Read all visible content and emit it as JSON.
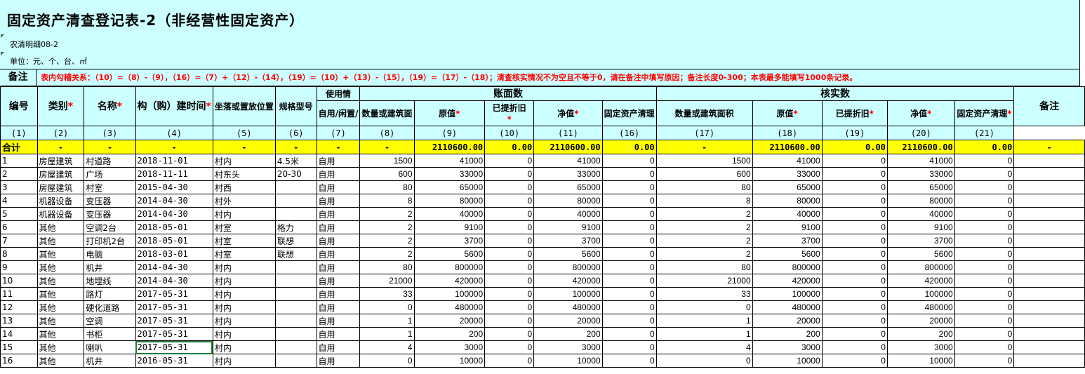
{
  "title": "固定资产清查登记表-2（非经营性固定资产）",
  "form_code": "农清明细08-2",
  "unit": "单位：元、个、台、㎡",
  "note": {
    "label": "备注",
    "text": "表内勾稽关系：（10）=（8）-（9），（16）=（7）+（12）-（14），（19）=（10）+（13）-（15），（19）=（17）-（18）；清查核实情况不为空且不等于0，请在备注中填写原因；备注长度0-300；本表最多能填写1000条记录。"
  },
  "headers": {
    "no": "编号",
    "category": "类别",
    "name": "名称",
    "build_time": "构（购）建时间",
    "location": "坐落或置放位置",
    "spec": "规格型号",
    "usage": "使用情",
    "usage_sub": "自用/闲置/",
    "book": "账面数",
    "book_qty": "数量或建筑面",
    "book_orig": "原值",
    "book_dep": "已提折旧",
    "book_net": "净值",
    "book_clear": "固定资产清理",
    "verify": "核实数",
    "ver_qty": "数量或建筑面积",
    "ver_orig": "原值",
    "ver_dep": "已提折旧",
    "ver_net": "净值",
    "ver_clear": "固定资产清理",
    "remark": "备注",
    "required_mark": "*"
  },
  "col_numbers": [
    "(1)",
    "(2)",
    "(3)",
    "(4)",
    "(5)",
    "(6)",
    "(7)",
    "(8)",
    "(9)",
    "(10)",
    "(11)",
    "(16)",
    "(17)",
    "(18)",
    "(19)",
    "(20)",
    "(21)"
  ],
  "totals": {
    "label": "合计",
    "dash": "-",
    "book_orig": "2110600.00",
    "book_dep": "0.00",
    "book_net": "2110600.00",
    "book_clear": "0.00",
    "ver_orig": "2110600.00",
    "ver_dep": "0.00",
    "ver_net": "2110600.00",
    "ver_clear": "0.00"
  },
  "rows": [
    [
      "1",
      "房屋建筑",
      "村道路",
      "2018-11-01",
      "村内",
      "4.5米",
      "自用",
      "1500",
      "41000",
      "0",
      "41000",
      "0",
      "1500",
      "41000",
      "0",
      "41000",
      "0",
      ""
    ],
    [
      "2",
      "房屋建筑",
      "广场",
      "2018-11-11",
      "村东头",
      "20-30",
      "自用",
      "600",
      "33000",
      "0",
      "33000",
      "0",
      "600",
      "33000",
      "0",
      "33000",
      "0",
      ""
    ],
    [
      "3",
      "房屋建筑",
      "村室",
      "2015-04-30",
      "村西",
      "",
      "自用",
      "80",
      "65000",
      "0",
      "65000",
      "0",
      "80",
      "65000",
      "0",
      "65000",
      "0",
      ""
    ],
    [
      "4",
      "机器设备",
      "变压器",
      "2014-04-30",
      "村外",
      "",
      "自用",
      "8",
      "80000",
      "0",
      "80000",
      "0",
      "8",
      "80000",
      "0",
      "80000",
      "0",
      ""
    ],
    [
      "5",
      "机器设备",
      "变压器",
      "2014-04-30",
      "村内",
      "",
      "自用",
      "2",
      "40000",
      "0",
      "40000",
      "0",
      "2",
      "40000",
      "0",
      "40000",
      "0",
      ""
    ],
    [
      "6",
      "其他",
      "空调2台",
      "2018-05-01",
      "村室",
      "格力",
      "自用",
      "2",
      "9100",
      "0",
      "9100",
      "0",
      "2",
      "9100",
      "0",
      "9100",
      "0",
      ""
    ],
    [
      "7",
      "其他",
      "打印机2台",
      "2018-05-01",
      "村室",
      "联想",
      "自用",
      "2",
      "3700",
      "0",
      "3700",
      "0",
      "2",
      "3700",
      "0",
      "3700",
      "0",
      ""
    ],
    [
      "8",
      "其他",
      "电脑",
      "2018-03-01",
      "村室",
      "联想",
      "自用",
      "2",
      "5600",
      "0",
      "5600",
      "0",
      "2",
      "5600",
      "0",
      "5600",
      "0",
      ""
    ],
    [
      "9",
      "其他",
      "机井",
      "2014-04-30",
      "村内",
      "",
      "自用",
      "80",
      "800000",
      "0",
      "800000",
      "0",
      "80",
      "800000",
      "0",
      "800000",
      "0",
      ""
    ],
    [
      "10",
      "其他",
      "地埋线",
      "2014-04-30",
      "村内",
      "",
      "自用",
      "21000",
      "420000",
      "0",
      "420000",
      "0",
      "21000",
      "420000",
      "0",
      "420000",
      "0",
      ""
    ],
    [
      "11",
      "其他",
      "路灯",
      "2017-05-31",
      "村内",
      "",
      "自用",
      "33",
      "100000",
      "0",
      "100000",
      "0",
      "33",
      "100000",
      "0",
      "100000",
      "0",
      ""
    ],
    [
      "12",
      "其他",
      "硬化道路",
      "2017-05-31",
      "村内",
      "",
      "自用",
      "0",
      "480000",
      "0",
      "480000",
      "0",
      "0",
      "480000",
      "0",
      "480000",
      "0",
      ""
    ],
    [
      "13",
      "其他",
      "空调",
      "2017-05-31",
      "村内",
      "",
      "自用",
      "1",
      "20000",
      "0",
      "20000",
      "0",
      "1",
      "20000",
      "0",
      "20000",
      "0",
      ""
    ],
    [
      "14",
      "其他",
      "书柜",
      "2017-05-31",
      "村内",
      "",
      "自用",
      "1",
      "200",
      "0",
      "200",
      "0",
      "1",
      "200",
      "0",
      "200",
      "0",
      ""
    ],
    [
      "15",
      "其他",
      "喇叭",
      "2017-05-31",
      "村内",
      "",
      "自用",
      "4",
      "3000",
      "0",
      "3000",
      "0",
      "4",
      "3000",
      "0",
      "3000",
      "0",
      ""
    ],
    [
      "16",
      "其他",
      "机井",
      "2016-05-31",
      "村内",
      "",
      "自用",
      "0",
      "10000",
      "0",
      "10000",
      "0",
      "0",
      "10000",
      "0",
      "10000",
      "0",
      ""
    ]
  ],
  "colors": {
    "header_bg": "#ccffff",
    "total_bg": "#ffff00",
    "required": "#ff0000",
    "selection": "#1f7a3a"
  }
}
